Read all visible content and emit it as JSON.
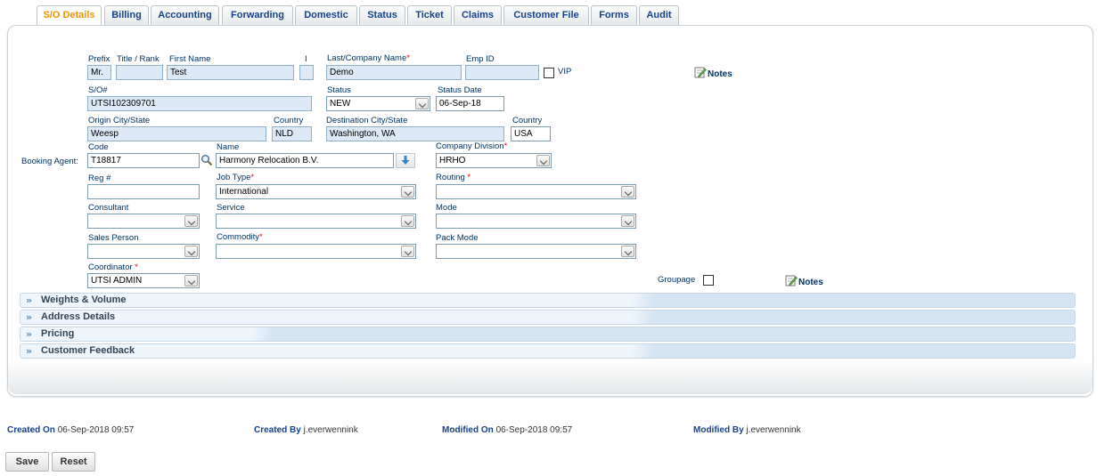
{
  "tabs": [
    "S/O Details",
    "Billing",
    "Accounting",
    "Forwarding",
    "Domestic",
    "Status",
    "Ticket",
    "Claims",
    "Customer File",
    "Forms",
    "Audit"
  ],
  "form": {
    "prefix_label": "Prefix",
    "prefix_value": "Mr.",
    "title_label": "Title / Rank",
    "title_value": "",
    "first_name_label": "First Name",
    "first_name_value": "Test",
    "initial_label": "I",
    "initial_value": "",
    "last_name_label": "Last/Company Name",
    "last_name_value": "Demo",
    "emp_id_label": "Emp ID",
    "emp_id_value": "",
    "vip_label": "VIP",
    "notes_label": "Notes",
    "so_label": "S/O#",
    "so_value": "UTSI102309701",
    "status_label": "Status",
    "status_value": "NEW",
    "status_date_label": "Status Date",
    "status_date_value": "06-Sep-18",
    "origin_label": "Origin City/State",
    "origin_value": "Weesp",
    "origin_country_label": "Country",
    "origin_country_value": "NLD",
    "dest_label": "Destination City/State",
    "dest_value": "Washington, WA",
    "dest_country_label": "Country",
    "dest_country_value": "USA",
    "booking_agent_label": "Booking Agent:",
    "code_label": "Code",
    "code_value": "T18817",
    "name_label": "Name",
    "name_value": "Harmony Relocation B.V.",
    "company_division_label": "Company Division",
    "company_division_value": "HRHO",
    "reg_label": "Reg #",
    "reg_value": "",
    "job_type_label": "Job Type",
    "job_type_value": "International",
    "routing_label": "Routing",
    "routing_value": "",
    "consultant_label": "Consultant",
    "consultant_value": "",
    "service_label": "Service",
    "service_value": "",
    "mode_label": "Mode",
    "mode_value": "",
    "sales_person_label": "Sales Person",
    "sales_person_value": "",
    "commodity_label": "Commodity",
    "commodity_value": "",
    "pack_mode_label": "Pack Mode",
    "pack_mode_value": "",
    "coordinator_label": "Coordinator",
    "coordinator_value": "UTSI ADMIN",
    "groupage_label": "Groupage",
    "req_mark": "*"
  },
  "sections": [
    "Weights & Volume",
    "Address Details",
    "Pricing",
    "Customer Feedback"
  ],
  "footer": {
    "created_on_label": "Created On",
    "created_on_value": "06-Sep-2018 09:57",
    "created_by_label": "Created By",
    "created_by_value": "j.everwennink",
    "modified_on_label": "Modified On",
    "modified_on_value": "06-Sep-2018 09:57",
    "modified_by_label": "Modified By",
    "modified_by_value": "j.everwennink"
  },
  "buttons": {
    "save": "Save",
    "reset": "Reset"
  },
  "colors": {
    "active_tab": "#f39200",
    "label": "#003366",
    "readonly_field": "#dde9f7",
    "required": "#ee0000"
  }
}
